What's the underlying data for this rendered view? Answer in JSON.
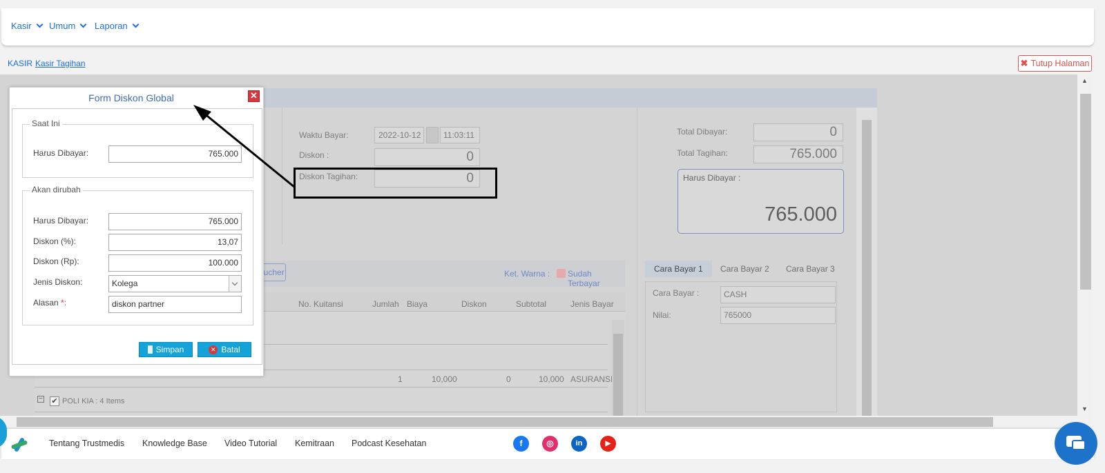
{
  "topnav": {
    "menus": [
      "Kasir",
      "Umum",
      "Laporan"
    ]
  },
  "breadcrumb": {
    "section": "KASIR",
    "page": "Kasir Tagihan"
  },
  "close_page_label": "Tutup Halaman",
  "overlay": {
    "waktu_label": "Waktu Bayar:",
    "date": "2022-10-12",
    "time": "11:03:11",
    "diskon_label": "Diskon :",
    "diskon_value": "0",
    "diskon_tagihan_label": "Diskon Tagihan:",
    "diskon_tagihan_value": "0",
    "total_dibayar_label": "Total Dibayar:",
    "total_dibayar_value": "0",
    "total_tagihan_label": "Total Tagihan:",
    "total_tagihan_value": "765.000",
    "harus_dibayar_label": "Harus Dibayar :",
    "harus_dibayar_value": "765.000",
    "voucher_label": "oucher",
    "ket_warna_label": "Ket. Warna :",
    "sudah_terbayar_label": "Sudah Terbayar",
    "grid_headers": [
      "No. Kuitansi",
      "Jumlah",
      "Biaya",
      "Diskon",
      "Subtotal",
      "Jenis Bayar"
    ],
    "grid_row": {
      "jumlah": "1",
      "biaya": "10,000",
      "diskon": "0",
      "subtotal": "10,000",
      "jenis_bayar": "ASURANSI"
    },
    "group_label": "POLI KIA : 4 Items",
    "pay_tabs": [
      "Cara Bayar 1",
      "Cara Bayar 2",
      "Cara Bayar 3"
    ],
    "cara_bayar_label": "Cara Bayar :",
    "cara_bayar_value": "CASH",
    "nilai_label": "Nilai:",
    "nilai_value": "765000"
  },
  "modal": {
    "title": "Form Diskon Global",
    "saat_ini": {
      "legend": "Saat Ini",
      "harus_dibayar_label": "Harus Dibayar:",
      "harus_dibayar_value": "765.000"
    },
    "akan_dirubah": {
      "legend": "Akan dirubah",
      "harus_dibayar_label": "Harus Dibayar:",
      "harus_dibayar_value": "765.000",
      "diskon_pct_label": "Diskon (%):",
      "diskon_pct_value": "13,07",
      "diskon_rp_label": "Diskon (Rp):",
      "diskon_rp_value": "100.000",
      "jenis_label": "Jenis Diskon:",
      "jenis_value": "Kolega",
      "alasan_label": "Alasan",
      "alasan_required": "*:",
      "alasan_value": "diskon partner"
    },
    "save_label": "Simpan",
    "cancel_label": "Batal"
  },
  "footer": {
    "links": [
      "Tentang Trustmedis",
      "Knowledge Base",
      "Video Tutorial",
      "Kemitraan",
      "Podcast Kesehatan"
    ],
    "social_icons": [
      "facebook-icon",
      "instagram-icon",
      "linkedin-icon",
      "youtube-icon"
    ]
  },
  "colors": {
    "accent": "#1e6fd9",
    "danger": "#d9534f",
    "button": "#13a3d8"
  }
}
